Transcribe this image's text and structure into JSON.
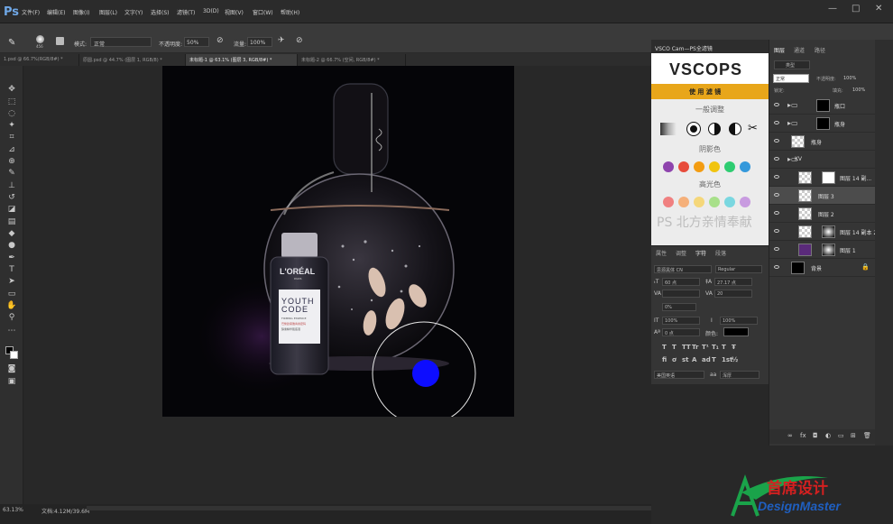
{
  "menubar": {
    "logo": "Ps",
    "items": [
      "文件(F)",
      "编辑(E)",
      "图像(I)",
      "图层(L)",
      "文字(Y)",
      "选择(S)",
      "滤镜(T)",
      "3D(D)",
      "视图(V)",
      "窗口(W)",
      "帮助(H)"
    ],
    "win_min": "—",
    "win_max": "□",
    "win_close": "✕"
  },
  "options": {
    "size_value": "456",
    "mode_label": "模式:",
    "mode_value": "正常",
    "opacity_label": "不透明度:",
    "opacity_value": "50%",
    "flow_label": "流量:",
    "flow_value": "100%"
  },
  "tabs": [
    {
      "label": "1.psd @ 66.7%(RGB/8#) *",
      "active": false
    },
    {
      "label": "原圆.psd @ 44.7% (图层 1, RGB/8) *",
      "active": false
    },
    {
      "label": "未标题-1 @ 63.1% (图层 3, RGB/8#) *",
      "active": true
    },
    {
      "label": "未标题-2 @ 66.7% (空间, RGB/8#) *",
      "active": false
    }
  ],
  "product": {
    "brand": "L'ORÉAL",
    "brand_sub": "PARIS",
    "line1": "YOUTH",
    "line2": "CODE",
    "small1": "FIRMING ESSENCE",
    "small2": "巴黎欧莱雅青春密码",
    "small3": "酵素精华肌底液"
  },
  "statusbar": {
    "zoom": "63.13%",
    "doc": "文档:4.12M/39.6M"
  },
  "vsco": {
    "title": "VSCO Cam—PS全滤镜",
    "logo": "VSCOPS",
    "use_filter": "使 用 滤 镜",
    "general": "一般调整",
    "shadow": "阴影色",
    "highlight": "高光色",
    "footer": "PS 北方亲情奉献",
    "accent": "#e8a61a",
    "shadow_colors": [
      "#8e44ad",
      "#e74c3c",
      "#f39c12",
      "#f1c40f",
      "#2ecc71",
      "#3498db"
    ],
    "highlight_colors": [
      "#f08080",
      "#f5b07a",
      "#f5d77a",
      "#a8e08a",
      "#7ad7e0",
      "#c89be0"
    ]
  },
  "charpanel": {
    "tabs": [
      "属性",
      "调整",
      "字符",
      "段落"
    ],
    "font": "思源黑体 CN",
    "style": "Regular",
    "size": "60 点",
    "leading": "27.17 点",
    "kerning": "VA",
    "tracking": "20",
    "scale_pct": "0%",
    "vscale": "100%",
    "hscale": "100%",
    "baseline": "0 点",
    "color_label": "颜色:",
    "styles": [
      "T",
      "T",
      "TT",
      "Tr",
      "T¹",
      "T₁",
      "T",
      "Ŧ"
    ],
    "ot": [
      "fi",
      "ơ",
      "st",
      "A",
      "ad",
      "T",
      "1st",
      "½"
    ],
    "lang": "美国英语",
    "aa_label": "aa",
    "aa": "浑厚"
  },
  "layers": {
    "tabs": [
      "图层",
      "通道",
      "路径"
    ],
    "kind": "类型",
    "mode": "正常",
    "opacity_label": "不透明度:",
    "opacity": "100%",
    "lock_label": "锁定:",
    "fill_label": "填充:",
    "fill": "100%",
    "items": [
      {
        "name": "瓶口",
        "type": "group"
      },
      {
        "name": "瓶身",
        "type": "group"
      },
      {
        "name": "瓶身",
        "type": "layer"
      },
      {
        "name": "KV",
        "type": "group"
      },
      {
        "name": "图层 14 副...",
        "type": "layer"
      },
      {
        "name": "图层 3",
        "type": "layer",
        "selected": true
      },
      {
        "name": "图层 2",
        "type": "layer"
      },
      {
        "name": "图层 14 副本 2",
        "type": "layer"
      },
      {
        "name": "图层 1",
        "type": "layer"
      },
      {
        "name": "背景",
        "type": "layer"
      }
    ],
    "bottom_icons": [
      "link-icon",
      "fx-icon",
      "mask-icon",
      "adjust-icon",
      "folder-icon",
      "new-layer-icon",
      "trash-icon"
    ]
  },
  "watermark": {
    "brand_cn": "首席设计",
    "brand_en": "DesignMaster"
  }
}
